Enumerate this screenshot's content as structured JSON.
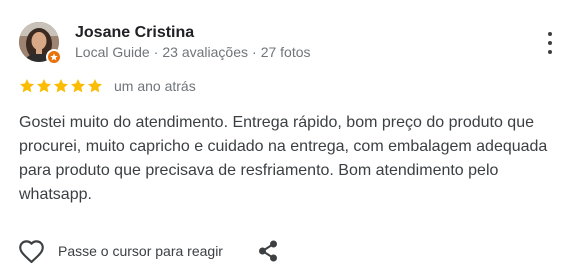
{
  "review": {
    "author_name": "Josane Cristina",
    "guide_label": "Local Guide",
    "separator": "·",
    "reviews_count": "23 avaliações",
    "photos_count": "27 fotos",
    "rating": 5,
    "max_rating": 5,
    "time_ago": "um ano atrás",
    "text": "Gostei muito do atendimento. Entrega rápido, bom preço do produto que procurei, muito capricho e cuidado na entrega, com embalagem adequada para produto que precisava de resfriamento. Bom atendimento pelo whatsapp."
  },
  "actions": {
    "like_label": "Passe o cursor para reagir"
  },
  "colors": {
    "star": "#fbbc04",
    "badge": "#e8710a",
    "secondary_text": "#70757a"
  },
  "icons": {
    "avatar": "user-photo",
    "badge": "local-guide-star-badge-icon",
    "more": "more-vert-icon",
    "star": "star-icon",
    "like": "heart-outline-icon",
    "share": "share-icon"
  }
}
